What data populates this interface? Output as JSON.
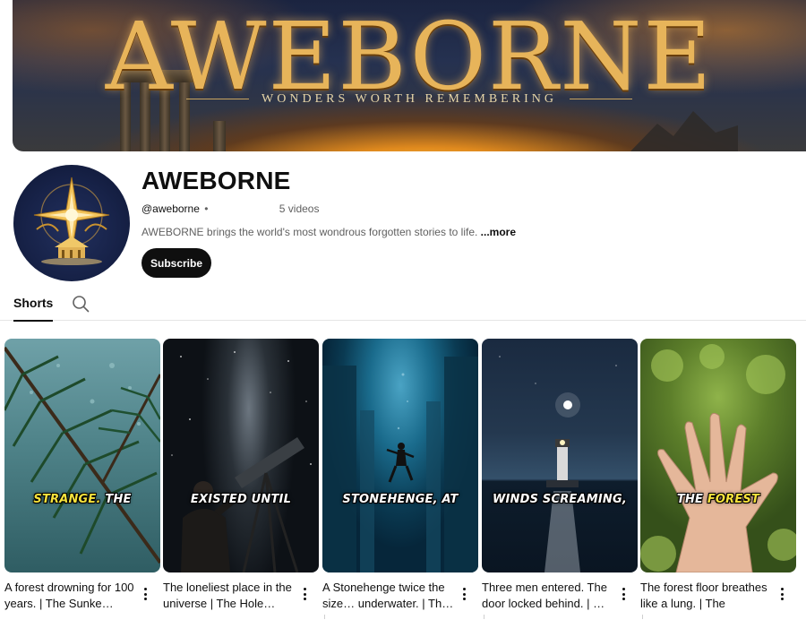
{
  "banner": {
    "title": "AWEBORNE",
    "tagline": "WONDERS WORTH REMEMBERING"
  },
  "channel": {
    "name": "AWEBORNE",
    "handle": "@aweborne",
    "separator": "•",
    "video_count": "5 videos",
    "description": "AWEBORNE brings the world's most wondrous forgotten stories to life.",
    "more_label": "...more",
    "subscribe_label": "Subscribe"
  },
  "tabs": {
    "shorts_label": "Shorts",
    "search_icon": "search-icon"
  },
  "shorts": [
    {
      "caption_hl": "STRANGE.",
      "caption_rest": " THE",
      "title": "A forest drowning for 100 years. | The Sunke…"
    },
    {
      "caption_hl": "",
      "caption_rest": "EXISTED UNTIL",
      "title": "The loneliest place in the universe | The Hole…"
    },
    {
      "caption_hl": "",
      "caption_rest": "STONEHENGE, AT",
      "title": "A Stonehenge twice the size… underwater. | Th…"
    },
    {
      "caption_hl": "",
      "caption_rest": "WINDS SCREAMING,",
      "title": "Three men entered. The door locked behind. | …"
    },
    {
      "caption_hl": "FOREST",
      "caption_pre": "THE ",
      "title": "The forest floor breathes like a lung. | The Forest…"
    }
  ],
  "colors": {
    "caption_highlight": "#f7e23c",
    "subscribe_bg": "#0f0f0f",
    "banner_gold": "#e7b45a"
  }
}
